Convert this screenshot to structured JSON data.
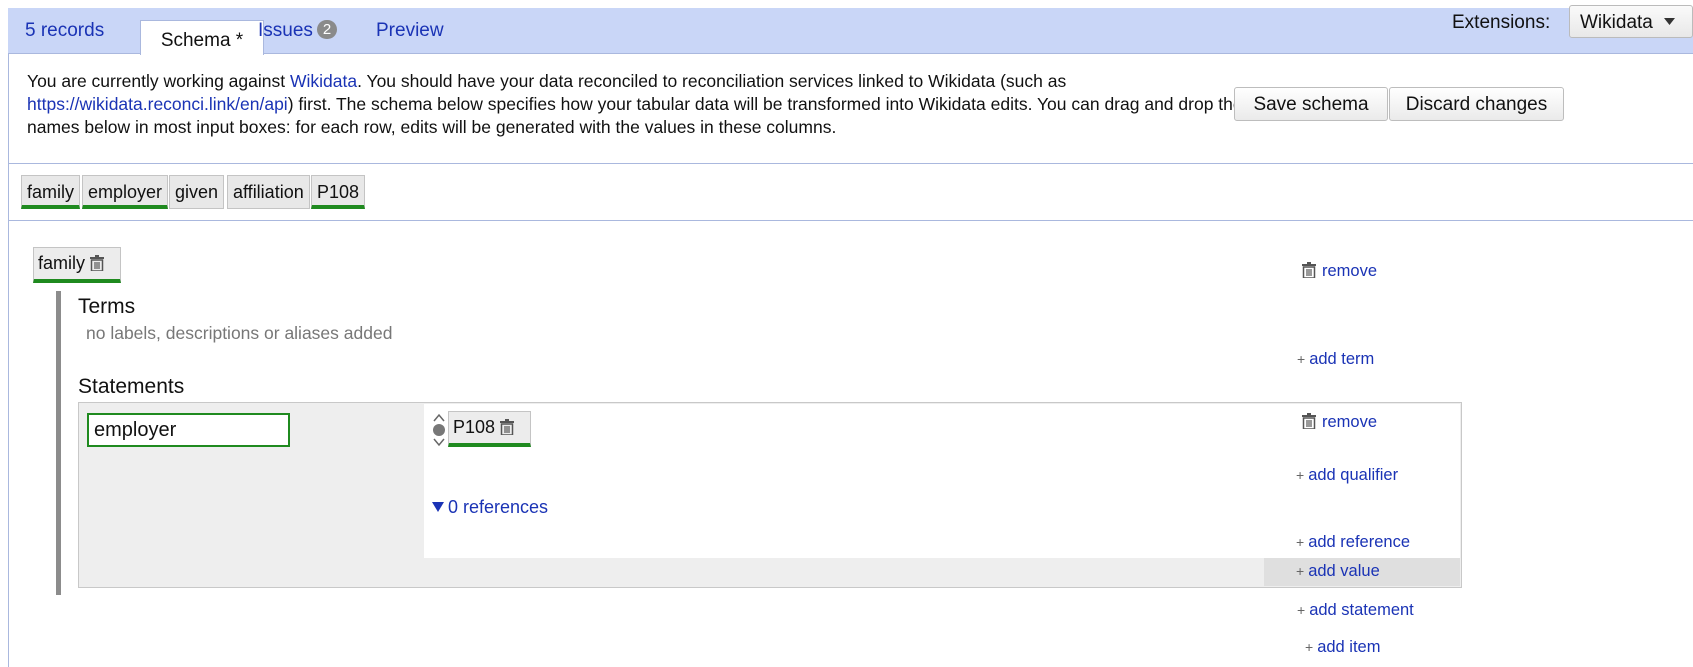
{
  "tabs": {
    "records": "5 records",
    "schema": "Schema *",
    "issues_label": "Issues",
    "issues_count": "2",
    "preview": "Preview"
  },
  "extensions": {
    "label": "Extensions:",
    "value": "Wikidata"
  },
  "info": {
    "part1": "You are currently working against ",
    "wikidata_link": "Wikidata",
    "part2": ". You should have your data reconciled to reconciliation services linked to Wikidata (such as ",
    "reconci_link": "https://wikidata.reconci.link/en/api",
    "part3": ") first. The schema below specifies how your tabular data will be transformed into Wikidata edits. You can drag and drop the column names below in most input boxes: for each row, edits will be generated with the values in these columns."
  },
  "buttons": {
    "save": "Save schema",
    "discard": "Discard changes"
  },
  "columns": [
    "family",
    "employer",
    "given",
    "affiliation",
    "P108"
  ],
  "item": {
    "subject": "family",
    "remove": "remove",
    "terms_heading": "Terms",
    "terms_empty": "no labels, descriptions or aliases added",
    "add_term": "add term",
    "statements_heading": "Statements",
    "add_statement": "add statement",
    "add_item": "add item"
  },
  "statement": {
    "property": "employer",
    "value": "P108",
    "remove": "remove",
    "add_qualifier": "add qualifier",
    "references": "0 references",
    "add_reference": "add reference",
    "add_value": "add value"
  },
  "icons": {
    "trash": "trash-icon",
    "plus": "plus-icon",
    "triangle_down": "triangle-down-icon",
    "rank": "rank-selector-icon",
    "caret": "caret-down-icon"
  },
  "colors": {
    "tabbar": "#c9d6f7",
    "link": "#1a33b5",
    "matched_underline": "#1f8a1f",
    "left_bar": "#8c8c8c"
  }
}
